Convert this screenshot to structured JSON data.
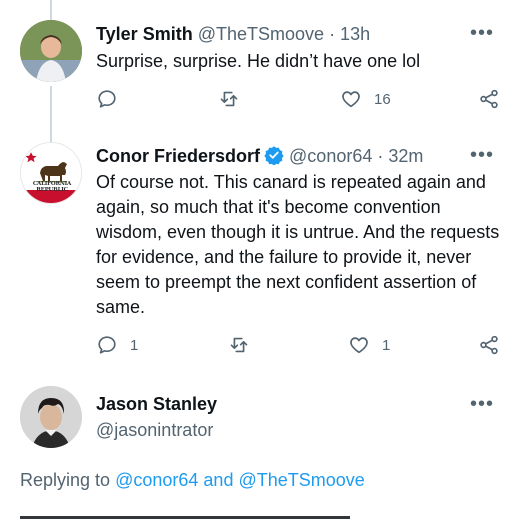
{
  "tweets": [
    {
      "name": "Tyler Smith",
      "handle": "@TheTSmoove",
      "time": "· 13h",
      "text": "Surprise, surprise. He didn’t have one lol",
      "reply_count": "",
      "retweet_count": "",
      "like_count": "16"
    },
    {
      "name": "Conor Friedersdorf",
      "handle": "@conor64",
      "time": "· 32m",
      "text": "Of course not. This canard is repeated again and again, so much that it's become convention wisdom, even though it is untrue. And the requests for evidence, and the failure to provide it, never seem to preempt the next confident assertion of same.",
      "reply_count": "1",
      "retweet_count": "",
      "like_count": "1",
      "avatar_label": "CALIFORNIA REPUBLIC"
    },
    {
      "name": "Jason Stanley",
      "handle": "@jasonintrator"
    }
  ],
  "replying": {
    "prefix": "Replying to",
    "handle1": "@conor64",
    "conj": "and",
    "handle2": "@TheTSmoove"
  },
  "more_label": "•••",
  "colors": {
    "link": "#1d9bf0",
    "muted": "#536471",
    "verified": "#1d9bf0"
  }
}
